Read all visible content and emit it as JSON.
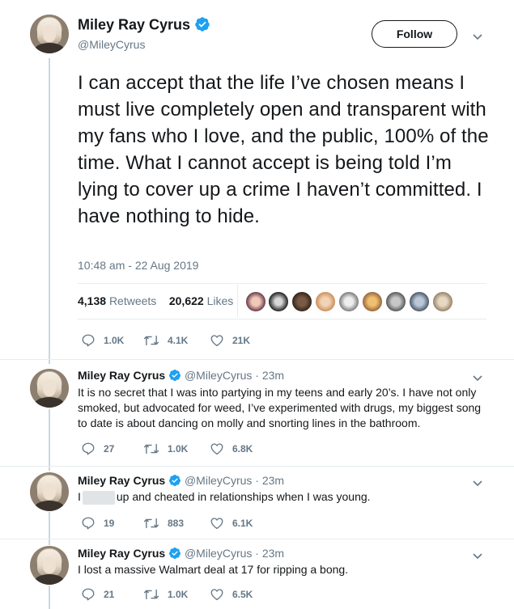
{
  "main_tweet": {
    "author_name": "Miley Ray Cyrus",
    "author_handle": "@MileyCyrus",
    "follow_label": "Follow",
    "text": "I can accept that the life I’ve chosen means I must live completely open and transparent with my fans who I love, and the public, 100% of the time. What I cannot accept is being told I’m lying to cover up a crime I haven’t committed. I have nothing to hide.",
    "timestamp": "10:48 am - 22 Aug 2019",
    "retweets_count": "4,138",
    "retweets_label": "Retweets",
    "likes_count": "20,622",
    "likes_label": "Likes",
    "actions": {
      "replies": "1.0K",
      "retweets": "4.1K",
      "likes": "21K"
    }
  },
  "replies": [
    {
      "author_name": "Miley Ray Cyrus",
      "author_handle": "@MileyCyrus · 23m",
      "text": "It is no secret that I was into partying in my teens and early 20’s. I have not only smoked, but advocated for weed, I’ve experimented with drugs, my biggest song to date is about dancing on molly and snorting lines in the bathroom.",
      "replies": "27",
      "retweets": "1.0K",
      "likes": "6.8K"
    },
    {
      "author_name": "Miley Ray Cyrus",
      "author_handle": "@MileyCyrus · 23m",
      "text_before": "I",
      "text_after": "up and cheated in relationships when I was young.",
      "replies": "19",
      "retweets": "883",
      "likes": "6.1K"
    },
    {
      "author_name": "Miley Ray Cyrus",
      "author_handle": "@MileyCyrus · 23m",
      "text": "I lost a massive Walmart deal at 17 for ripping a bong.",
      "replies": "21",
      "retweets": "1.0K",
      "likes": "6.5K"
    }
  ],
  "icons": {
    "verified": "verified-badge-icon",
    "chevron": "chevron-down-icon",
    "reply": "reply-icon",
    "retweet": "retweet-icon",
    "like": "heart-icon"
  },
  "colors": {
    "text": "#14171a",
    "secondary": "#657786",
    "verified_blue": "#1da1f2",
    "divider": "#e6ecf0",
    "thread_line": "#ccd6dd"
  }
}
